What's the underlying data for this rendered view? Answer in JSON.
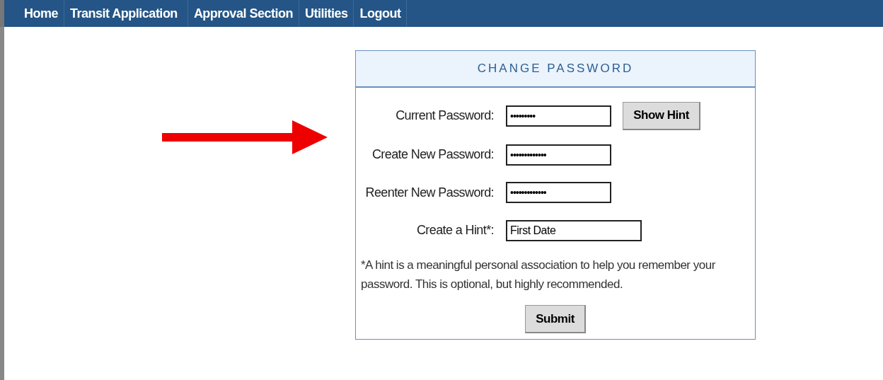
{
  "nav": [
    {
      "label": "Home"
    },
    {
      "label": "Transit Application"
    },
    {
      "label": "Approval Section"
    },
    {
      "label": "Utilities"
    },
    {
      "label": "Logout"
    }
  ],
  "panel": {
    "title": "CHANGE PASSWORD",
    "fields": [
      {
        "label": "Current Password:",
        "kind": "password",
        "value": "•••••••••",
        "button": "Show Hint"
      },
      {
        "label": "Create New Password:",
        "kind": "password",
        "value": "•••••••••••••"
      },
      {
        "label": "Reenter New Password:",
        "kind": "password",
        "value": "•••••••••••••"
      },
      {
        "label": "Create a Hint*:",
        "kind": "text",
        "value": "First Date"
      }
    ],
    "note": "*A hint is a meaningful personal association to help you remember your password. This is optional, but highly recommended.",
    "submit": "Submit"
  }
}
